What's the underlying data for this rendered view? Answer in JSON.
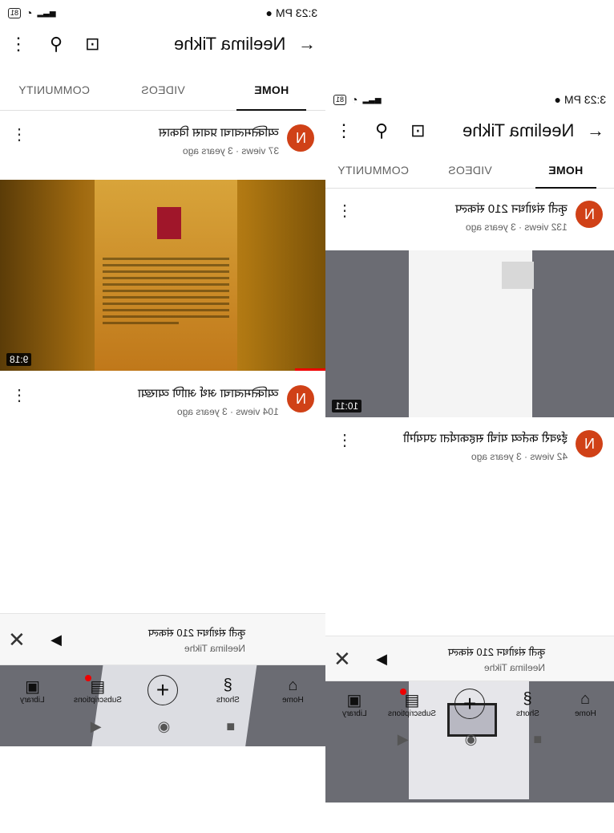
{
  "status": {
    "time": "3:23 PM",
    "battery": "81"
  },
  "channel": {
    "title": "Neelima Tikhe"
  },
  "tabs": [
    {
      "label": "HOME",
      "active": true
    },
    {
      "label": "VIDEOS",
      "active": false
    },
    {
      "label": "COMMUNITY",
      "active": false
    }
  ],
  "avatar_letter": "N",
  "main_videos": [
    {
      "title": "व्यक्तिमत्वाचा प्रवास विकास",
      "stats": "37 views · 3 years ago",
      "duration": "9:18"
    },
    {
      "title": "व्यक्तिमत्वाचा अर्थ आणि व्याख्या",
      "stats": "104 views · 3 years ago",
      "duration": ""
    }
  ],
  "mini_videos": [
    {
      "title": "कृती संशोधन 210 संकल्प",
      "stats": "132 views · 3 years ago",
      "duration": "10:11"
    },
    {
      "title": "ईश्वरी कर्तव्य यांची सहकार्यता उपयोगी",
      "stats": "42 views · 3 years ago",
      "duration": ""
    }
  ],
  "player": {
    "title": "कृती संशोधन 210 संकल्प",
    "channel": "Neelima Tikhe"
  },
  "nav": [
    {
      "label": "Home",
      "icon": "home-icon"
    },
    {
      "label": "Shorts",
      "icon": "shorts-icon"
    },
    {
      "label": "",
      "icon": "create-icon"
    },
    {
      "label": "Subscriptions",
      "icon": "subscriptions-icon"
    },
    {
      "label": "Library",
      "icon": "library-icon"
    }
  ],
  "colors": {
    "avatar": "#d04117",
    "progress": "#ee0000"
  }
}
